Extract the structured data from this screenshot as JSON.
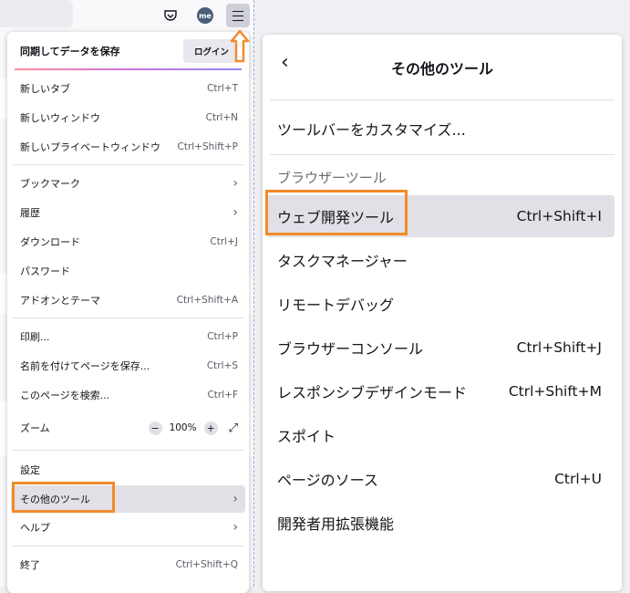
{
  "toolbar": {
    "avatar_initials": "me"
  },
  "main_menu": {
    "sync_label": "同期してデータを保存",
    "login_label": "ログイン",
    "items": [
      {
        "label": "新しいタブ",
        "shortcut": "Ctrl+T"
      },
      {
        "label": "新しいウィンドウ",
        "shortcut": "Ctrl+N"
      },
      {
        "label": "新しいプライベートウィンドウ",
        "shortcut": "Ctrl+Shift+P"
      },
      {
        "label": "ブックマーク"
      },
      {
        "label": "履歴"
      },
      {
        "label": "ダウンロード",
        "shortcut": "Ctrl+J"
      },
      {
        "label": "パスワード"
      },
      {
        "label": "アドオンとテーマ",
        "shortcut": "Ctrl+Shift+A"
      },
      {
        "label": "印刷...",
        "shortcut": "Ctrl+P"
      },
      {
        "label": "名前を付けてページを保存...",
        "shortcut": "Ctrl+S"
      },
      {
        "label": "このページを検索...",
        "shortcut": "Ctrl+F"
      },
      {
        "label": "ズーム"
      },
      {
        "label": "設定"
      },
      {
        "label": "その他のツール"
      },
      {
        "label": "ヘルプ"
      },
      {
        "label": "終了",
        "shortcut": "Ctrl+Shift+Q"
      }
    ],
    "zoom": {
      "minus": "−",
      "value": "100%",
      "plus": "+",
      "fullscreen": "⤢"
    }
  },
  "sub_menu": {
    "title": "その他のツール",
    "back_glyph": "‹",
    "customize_label": "ツールバーをカスタマイズ...",
    "section_label": "ブラウザーツール",
    "items": [
      {
        "label": "ウェブ開発ツール",
        "shortcut": "Ctrl+Shift+I"
      },
      {
        "label": "タスクマネージャー",
        "shortcut": ""
      },
      {
        "label": "リモートデバッグ",
        "shortcut": ""
      },
      {
        "label": "ブラウザーコンソール",
        "shortcut": "Ctrl+Shift+J"
      },
      {
        "label": "レスポンシブデザインモード",
        "shortcut": "Ctrl+Shift+M"
      },
      {
        "label": "スポイト",
        "shortcut": ""
      },
      {
        "label": "ページのソース",
        "shortcut": "Ctrl+U"
      },
      {
        "label": "開発者用拡張機能",
        "shortcut": ""
      }
    ]
  },
  "colors": {
    "highlight": "#f28a2b",
    "hover_bg": "#e0e0e6"
  }
}
